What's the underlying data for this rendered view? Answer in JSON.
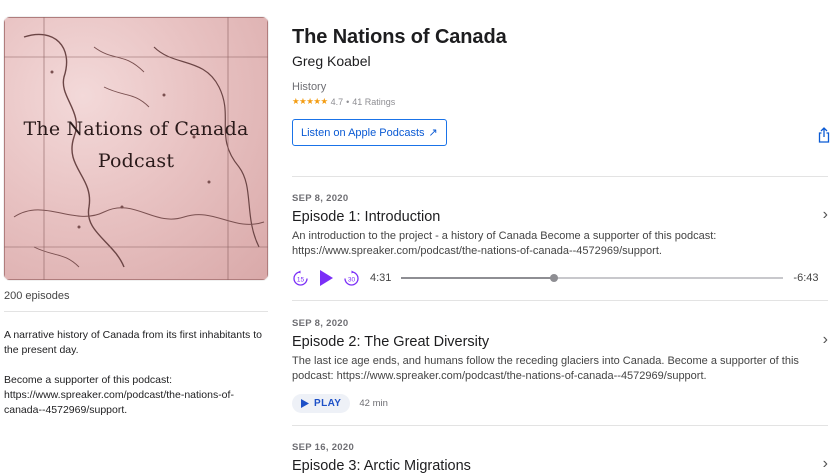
{
  "artwork": {
    "line1": "The Nations of Canada",
    "line2": "Podcast"
  },
  "sidebar": {
    "episode_count": "200 episodes",
    "description_p1": "A narrative history of Canada from its first inhabitants to the present day.",
    "description_p2": "Become a supporter of this podcast: https://www.spreaker.com/podcast/the-nations-of-canada--4572969/support."
  },
  "show": {
    "title": "The Nations of Canada",
    "author": "Greg Koabel",
    "genre": "History",
    "stars": "★★★★★",
    "rating": "4.7",
    "ratings_count": "41 Ratings",
    "listen_button": "Listen on Apple Podcasts",
    "listen_arrow": "↗"
  },
  "episodes": [
    {
      "date": "SEP 8, 2020",
      "title": "Episode 1: Introduction",
      "description": "An introduction to the project - a history of Canada Become a supporter of this podcast: https://www.spreaker.com/podcast/the-nations-of-canada--4572969/support.",
      "elapsed": "4:31",
      "remaining": "-6:43",
      "progress": 0.4
    },
    {
      "date": "SEP 8, 2020",
      "title": "Episode 2: The Great Diversity",
      "description": "The last ice age ends, and humans follow the receding glaciers into Canada. Become a supporter of this podcast: https://www.spreaker.com/podcast/the-nations-of-canada--4572969/support.",
      "play_label": "PLAY",
      "duration": "42 min"
    },
    {
      "date": "SEP 16, 2020",
      "title": "Episode 3: Arctic Migrations"
    }
  ],
  "icons": {
    "chevron": "›",
    "skip_back": "15",
    "skip_forward": "30"
  },
  "colors": {
    "accent": "#7b2ff7",
    "link": "#0a5ad4",
    "stars": "#f39c12"
  }
}
